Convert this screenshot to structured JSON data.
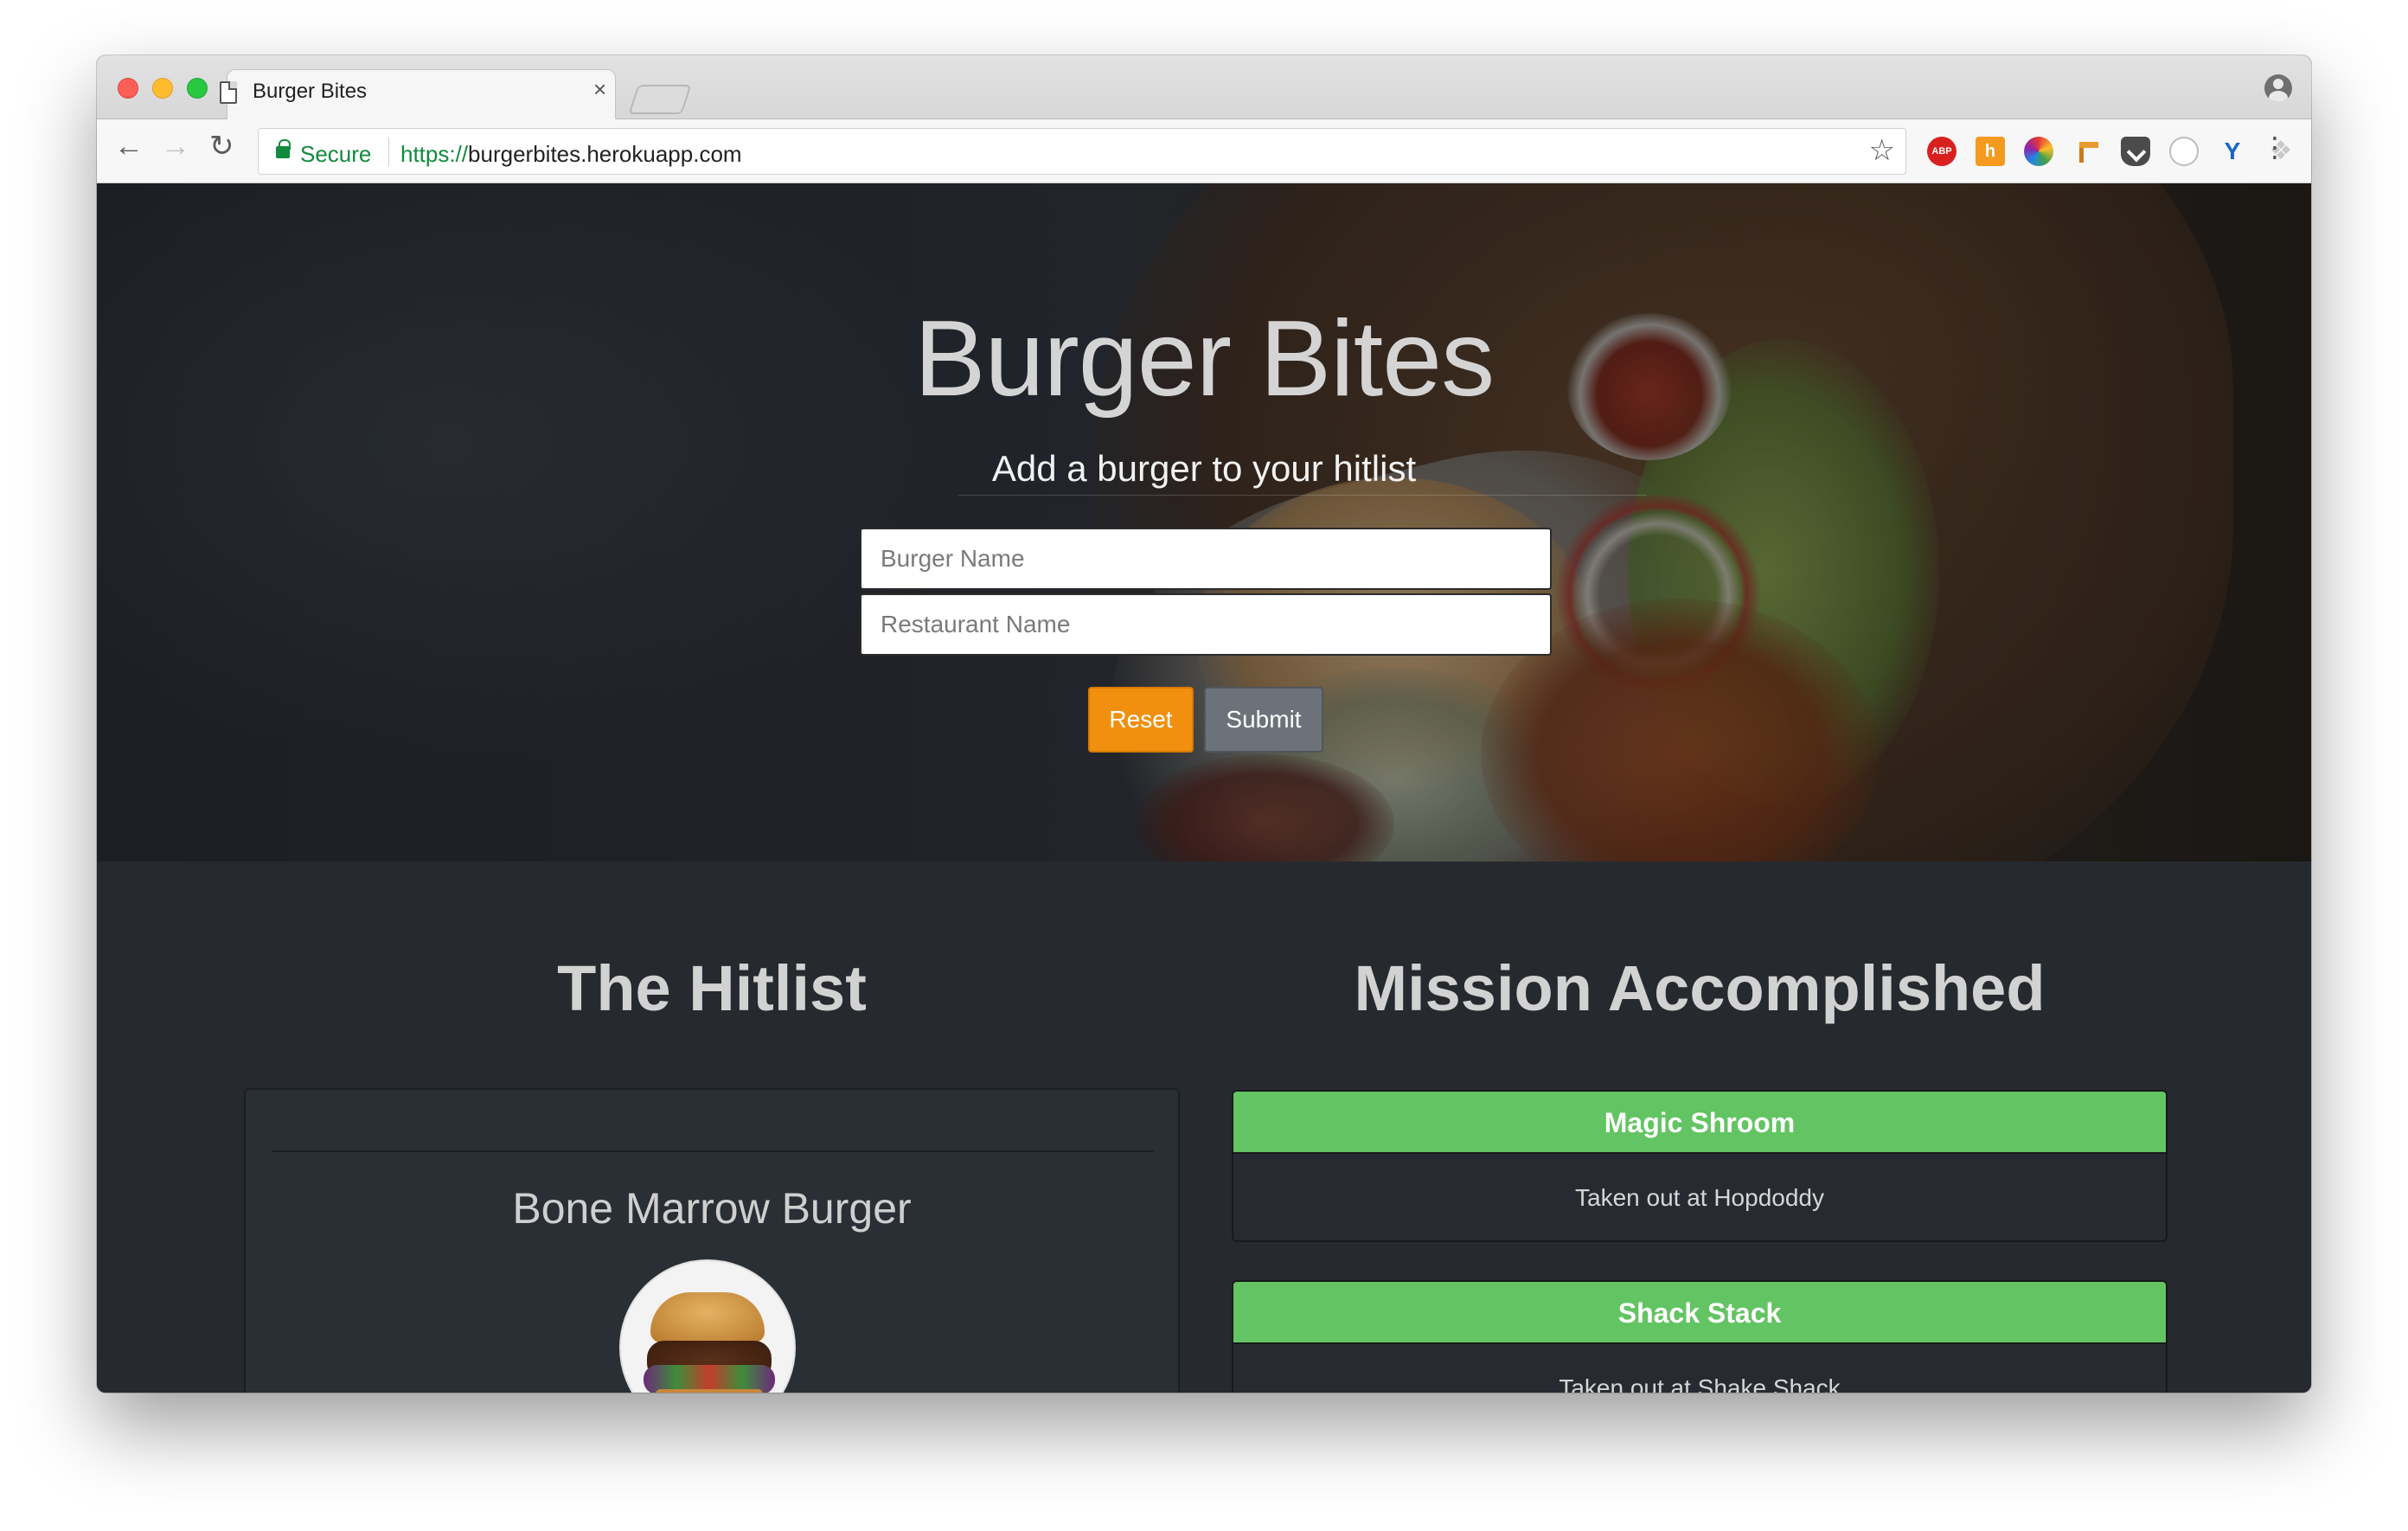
{
  "browser": {
    "tab_title": "Burger Bites",
    "tab_close": "×",
    "secure_label": "Secure",
    "url_scheme": "https://",
    "url_host": "burgerbites.herokuapp.com",
    "extensions": [
      "adblock-icon",
      "hacker-news-icon",
      "color-picker-icon",
      "bookmark-flag-icon",
      "pocket-icon",
      "circle-extension-icon",
      "vimium-icon",
      "dropbox-icon",
      "react-devtools-icon"
    ],
    "abp_text": "ABP",
    "hn_text": "h"
  },
  "hero": {
    "title": "Burger Bites",
    "subtitle": "Add a burger to your hitlist",
    "burger_placeholder": "Burger Name",
    "restaurant_placeholder": "Restaurant Name",
    "reset_label": "Reset",
    "submit_label": "Submit"
  },
  "hitlist": {
    "title": "The Hitlist",
    "items": [
      {
        "name": "Bone Marrow Burger"
      }
    ]
  },
  "mission": {
    "title": "Mission Accomplished",
    "items": [
      {
        "name": "Magic Shroom",
        "detail": "Taken out at Hopdoddy"
      },
      {
        "name": "Shack Stack",
        "detail": "Taken out at Shake Shack"
      }
    ]
  },
  "colors": {
    "accent_orange": "#f0900e",
    "accent_green": "#62c462",
    "secure_green": "#128a3e",
    "page_dark": "#262a2f"
  }
}
